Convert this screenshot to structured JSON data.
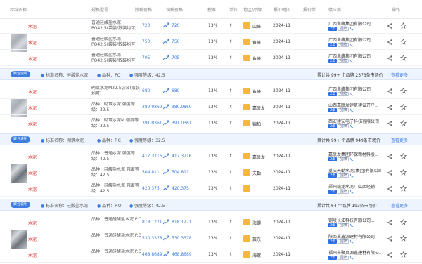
{
  "header": {
    "material": "材料名称",
    "spec": "规格型号",
    "tax_price": "除税价格",
    "incl_price": "含税价格",
    "tax_rate": "税率",
    "unit": "单位",
    "origin_brand": "地区/品牌",
    "date": "报价时间",
    "quoter": "报价单",
    "supplier": "供应商",
    "action": "操作"
  },
  "badges": {
    "year": "2年",
    "tag": "品牌"
  },
  "section1": {
    "rows": [
      {
        "name": "水泥",
        "spec": "普通硅酸盐水泥PO42.5(袋装/散装均可)",
        "tax_price": "720",
        "incl_price": "720",
        "tax": "13%",
        "unit": "t",
        "brand": "山峰",
        "date": "2024-11",
        "supplier": "广西鱼峰集团有限公司"
      },
      {
        "name": "水泥",
        "spec": "普通硅酸盐水泥PO42.5(袋装/散装均可)",
        "tax_price": "750",
        "incl_price": "750",
        "tax": "13%",
        "unit": "t",
        "brand": "鱼峰",
        "date": "2024-11",
        "supplier": "广西鱼峰集团有限公司"
      },
      {
        "name": "水泥",
        "spec": "普通硅酸盐水泥PO42.5(袋装/散装均可)",
        "tax_price": "705",
        "incl_price": "705",
        "tax": "13%",
        "unit": "t",
        "brand": "鱼峰",
        "date": "2024-11",
        "supplier": "广西鱼峰集团有限公司"
      }
    ],
    "summary": {
      "label": "聚合说明",
      "std": "标准名称：硅酸盐水泥",
      "kind": "品种：PO",
      "grade": "强度等级：42.5",
      "total": "累计共 99+ 个品牌 2373条市场价",
      "more": "查看更多"
    }
  },
  "section2": {
    "rows": [
      {
        "name": "水泥",
        "spec": "砌筑水泥M32.5袋装(散装均可)",
        "tax_price": "680",
        "incl_price": "680",
        "tax": "13%",
        "unit": "t",
        "brand": "鱼峰",
        "date": "2024-11",
        "supplier": "广西鱼峰集团有限公司"
      },
      {
        "name": "水泥",
        "spec": "品种：砌筑水泥 强度等级：32.5",
        "tax_price": "380.9869",
        "incl_price": "380.9869",
        "tax": "13%",
        "unit": "t",
        "brand": "嘉联发",
        "date": "2024-11",
        "supplier": "山西嘉联发建筑建设开户..."
      },
      {
        "name": "水泥",
        "spec": "品种：砌筑水泥M 强度等级：32.5",
        "tax_price": "391.0361",
        "incl_price": "391.0361",
        "tax": "13%",
        "unit": "t",
        "brand": "锦柏",
        "date": "2024-11",
        "supplier": "西安建安电子科技有限公司"
      }
    ],
    "summary": {
      "label": "聚合说明",
      "std": "标准名称：砌筑水泥",
      "kind": "品种：P.C",
      "grade": "强度等级：32.5",
      "total": "累计共 99+ 个品牌 949条市场价",
      "more": "查看更多"
    }
  },
  "section3": {
    "rows": [
      {
        "name": "水泥",
        "spec": "品种：普通水泥 强度等级：42.5",
        "tax_price": "417.3716",
        "incl_price": "417.3716",
        "tax": "13%",
        "unit": "t",
        "brand": "嘉联发",
        "date": "2024-11",
        "supplier": "嘉联发集团环保新材料股..."
      },
      {
        "name": "水泥",
        "spec": "品种：硅酸盐水泥 强度等级：42.5",
        "tax_price": "504.811",
        "incl_price": "504.811",
        "tax": "13%",
        "unit": "t",
        "brand": "天勤",
        "date": "2024-11",
        "supplier": "重庆天勤水泥(集团)有限公司"
      },
      {
        "name": "水泥",
        "spec": "品种：硅酸盐水泥 强度等级：42.5",
        "tax_price": "420.375",
        "incl_price": "420.375",
        "tax": "13%",
        "unit": "t",
        "brand": "",
        "date": "2024-11",
        "supplier": "郑州瑞龙水泥厂山西经销"
      }
    ],
    "summary": {
      "label": "聚合说明",
      "std": "标准名称：硅酸盐水泥",
      "kind": "品种：P.O",
      "grade": "强度等级：42.5",
      "total": "累计共 64 个品牌 193条市场价",
      "more": "查看更多"
    }
  },
  "section4": {
    "rows": [
      {
        "name": "水泥",
        "spec": "品种：普通硅酸盐水泥 P.O",
        "tax_price": "818.1271",
        "incl_price": "818.1271",
        "tax": "13%",
        "unit": "t",
        "brand": "海螺",
        "date": "2024-11",
        "supplier": "铜陵长江科技有限公司..."
      },
      {
        "name": "水泥",
        "spec": "品种：普通硅酸盐水泥 P.O",
        "tax_price": "530.3378",
        "incl_price": "530.3378",
        "tax": "13%",
        "unit": "t",
        "brand": "冀东",
        "date": "2024-11",
        "supplier": "陕西冀鑫源建材有限公司"
      },
      {
        "name": "水泥",
        "spec": "品种：普通硅酸盐水泥 P.O",
        "tax_price": "468.8689",
        "incl_price": "468.8689",
        "tax": "13%",
        "unit": "t",
        "brand": "海螺",
        "date": "2024-11",
        "supplier": "福州市聚贞源鑫建材有限公..."
      }
    ]
  }
}
